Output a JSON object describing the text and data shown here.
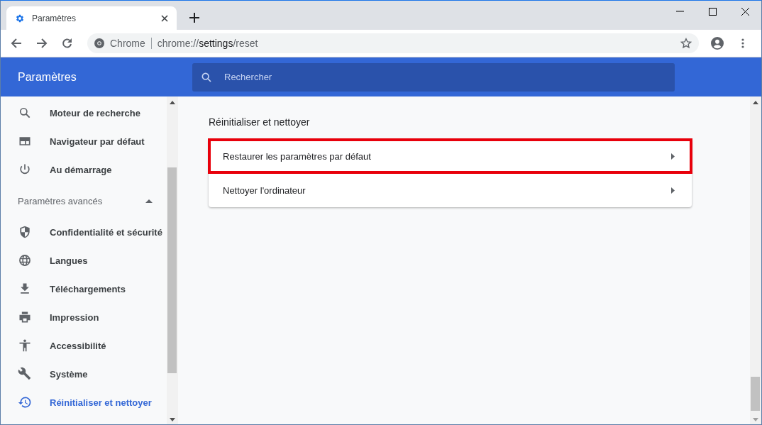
{
  "tab": {
    "title": "Paramètres",
    "selected": true
  },
  "address": {
    "site": "Chrome",
    "url_prefix": "chrome://",
    "url_host": "settings",
    "url_path": "/reset"
  },
  "header": {
    "title": "Paramètres",
    "search": {
      "placeholder": "Rechercher"
    }
  },
  "sidebar": {
    "items": [
      {
        "label": "Moteur de recherche",
        "selected": false
      },
      {
        "label": "Navigateur par défaut",
        "selected": false
      },
      {
        "label": "Au démarrage",
        "selected": false
      }
    ],
    "advanced": {
      "label": "Paramètres avancés",
      "expanded": true,
      "items": [
        {
          "label": "Confidentialité et sécurité",
          "selected": false
        },
        {
          "label": "Langues",
          "selected": false
        },
        {
          "label": "Téléchargements",
          "selected": false
        },
        {
          "label": "Impression",
          "selected": false
        },
        {
          "label": "Accessibilité",
          "selected": false
        },
        {
          "label": "Système",
          "selected": false
        },
        {
          "label": "Réinitialiser et nettoyer",
          "selected": true
        }
      ]
    }
  },
  "section": {
    "title": "Réinitialiser et nettoyer",
    "rows": [
      {
        "label": "Restaurer les paramètres par défaut",
        "highlighted": true
      },
      {
        "label": "Nettoyer l'ordinateur",
        "highlighted": false
      }
    ]
  }
}
